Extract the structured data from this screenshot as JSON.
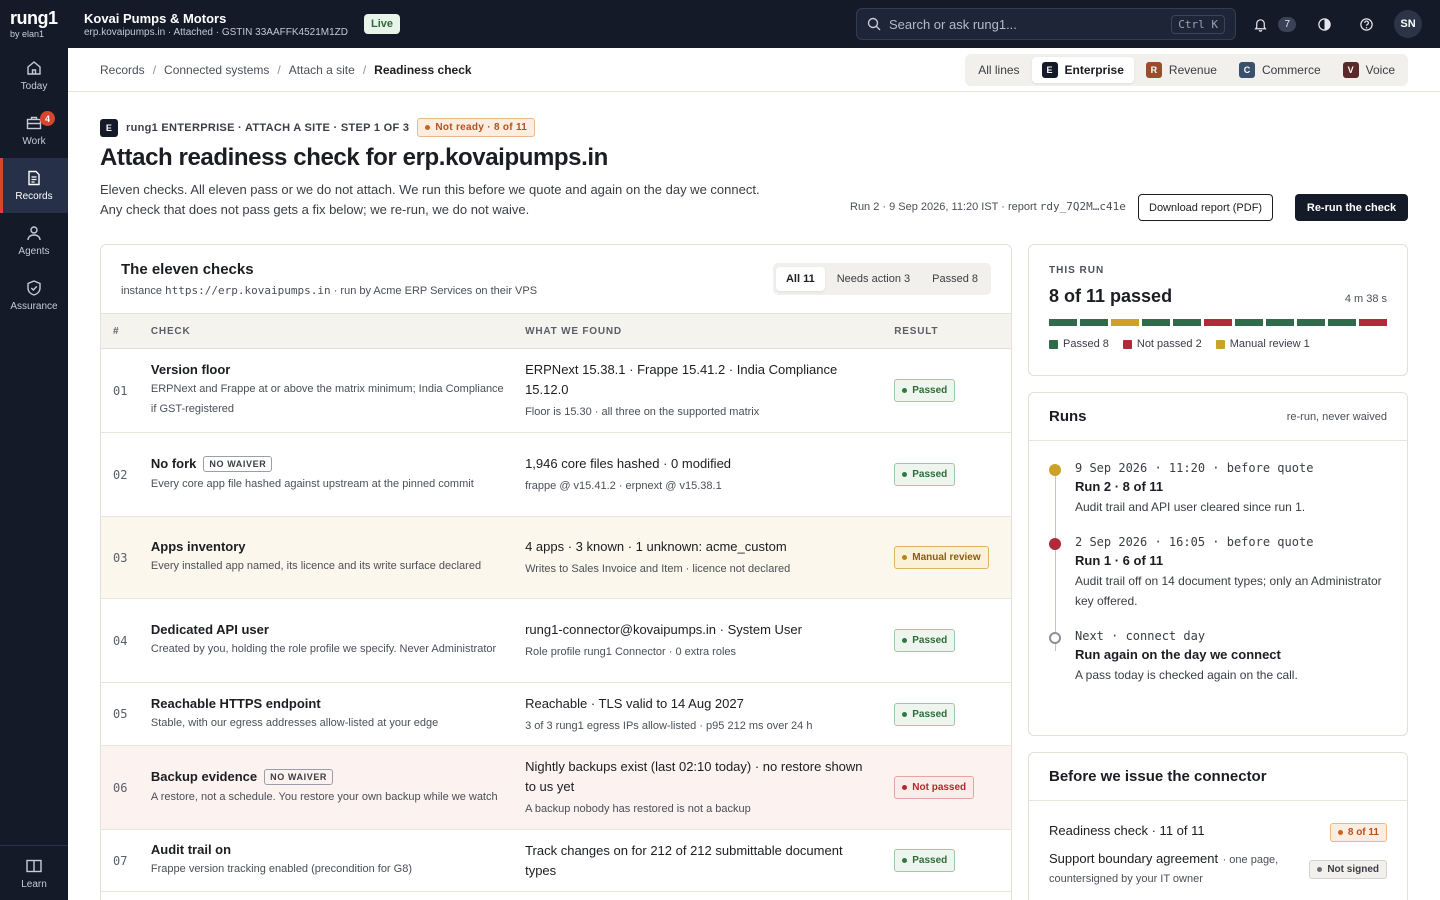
{
  "topbar": {
    "logo": "rung1",
    "logo_sub": "by elan1",
    "org_name": "Kovai Pumps & Motors",
    "org_sub": "erp.kovaipumps.in · Attached · GSTIN 33AAFFK4521M1ZD",
    "live": "Live",
    "search_placeholder": "Search or ask rung1...",
    "search_kbd": "Ctrl K",
    "notif_count": "7",
    "avatar": "SN"
  },
  "nav": {
    "items": [
      {
        "label": "Today",
        "icon": "home-icon"
      },
      {
        "label": "Work",
        "icon": "briefcase-icon",
        "badge": "4"
      },
      {
        "label": "Records",
        "icon": "document-icon"
      },
      {
        "label": "Agents",
        "icon": "person-icon"
      },
      {
        "label": "Assurance",
        "icon": "shield-check-icon"
      }
    ],
    "learn": "Learn"
  },
  "breadcrumb": [
    "Records",
    "Connected systems",
    "Attach a site",
    "Readiness check"
  ],
  "lines": {
    "all": "All lines",
    "tabs": [
      {
        "chip": "E",
        "label": "Enterprise",
        "color": "#141a27"
      },
      {
        "chip": "R",
        "label": "Revenue",
        "color": "#9a4d2c"
      },
      {
        "chip": "C",
        "label": "Commerce",
        "color": "#3b4f6e"
      },
      {
        "chip": "V",
        "label": "Voice",
        "color": "#5a2a2a"
      }
    ]
  },
  "header": {
    "chip": "E",
    "eyebrow": "rung1 ENTERPRISE · ATTACH A SITE · STEP 1 OF 3",
    "status": "Not ready · 8 of 11",
    "title": "Attach readiness check for erp.kovaipumps.in",
    "lede": "Eleven checks. All eleven pass or we do not attach. We run this before we quote and again on the day we connect. Any check that does not pass gets a fix below; we re-run, we do not waive.",
    "run_meta": "Run 2 · 9 Sep 2026, 11:20 IST · report",
    "report_id": "rdy_7Q2M…c41e",
    "download": "Download report (PDF)",
    "rerun": "Re-run the check"
  },
  "checks": {
    "title": "The eleven checks",
    "sub_prefix": "instance",
    "sub_url": "https://erp.kovaipumps.in",
    "sub_suffix": "· run by Acme ERP Services on their VPS",
    "filters": [
      "All 11",
      "Needs action 3",
      "Passed 8"
    ],
    "columns": [
      "#",
      "CHECK",
      "WHAT WE FOUND",
      "RESULT"
    ],
    "rows": [
      {
        "num": "01",
        "title": "Version floor",
        "tag": "",
        "desc": "ERPNext and Frappe at or above the matrix minimum; India Compliance if GST-registered",
        "found": "ERPNext 15.38.1 · Frappe 15.41.2 · India Compliance 15.12.0",
        "found_sub": "Floor is 15.30 · all three on the supported matrix",
        "result": "Passed",
        "kind": "pass"
      },
      {
        "num": "02",
        "title": "No fork",
        "tag": "NO WAIVER",
        "desc": "Every core app file hashed against upstream at the pinned commit",
        "found": "1,946 core files hashed · 0 modified",
        "found_sub": "frappe @ v15.41.2 · erpnext @ v15.38.1",
        "result": "Passed",
        "kind": "pass"
      },
      {
        "num": "03",
        "title": "Apps inventory",
        "tag": "",
        "desc": "Every installed app named, its licence and its write surface declared",
        "found": "4 apps · 3 known · 1 unknown: acme_custom",
        "found_sub": "Writes to Sales Invoice and Item · licence not declared",
        "result": "Manual review",
        "kind": "review"
      },
      {
        "num": "04",
        "title": "Dedicated API user",
        "tag": "",
        "desc": "Created by you, holding the role profile we specify. Never Administrator",
        "found": "rung1-connector@kovaipumps.in · System User",
        "found_sub": "Role profile rung1 Connector · 0 extra roles",
        "result": "Passed",
        "kind": "pass"
      },
      {
        "num": "05",
        "title": "Reachable HTTPS endpoint",
        "tag": "",
        "desc": "Stable, with our egress addresses allow-listed at your edge",
        "found": "Reachable · TLS valid to 14 Aug 2027",
        "found_sub": "3 of 3 rung1 egress IPs allow-listed · p95 212 ms over 24 h",
        "result": "Passed",
        "kind": "pass"
      },
      {
        "num": "06",
        "title": "Backup evidence",
        "tag": "NO WAIVER",
        "desc": "A restore, not a schedule. You restore your own backup while we watch",
        "found": "Nightly backups exist (last 02:10 today) · no restore shown to us yet",
        "found_sub": "A backup nobody has restored is not a backup",
        "result": "Not passed",
        "kind": "fail"
      },
      {
        "num": "07",
        "title": "Audit trail on",
        "tag": "",
        "desc": "Frappe version tracking enabled (precondition for G8)",
        "found": "Track changes on for 212 of 212 submittable document types",
        "found_sub": "",
        "result": "Passed",
        "kind": "pass"
      }
    ]
  },
  "this_run": {
    "label": "THIS RUN",
    "value": "8 of 11 passed",
    "time": "4 m 38 s",
    "segments": [
      "pass",
      "pass",
      "review",
      "pass",
      "pass",
      "fail",
      "pass",
      "pass",
      "pass",
      "pass",
      "fail"
    ],
    "legend": [
      "Passed 8",
      "Not passed 2",
      "Manual review 1"
    ],
    "colors": {
      "pass": "#2f6b4a",
      "fail": "#b02a3a",
      "review": "#c9a227"
    }
  },
  "runs": {
    "title": "Runs",
    "sub": "re-run, never waived",
    "items": [
      {
        "meta": "9 Sep 2026 · 11:20 · before quote",
        "title": "Run 2 · 8 of 11",
        "desc": "Audit trail and API user cleared since run 1.",
        "dot": "#c9a227"
      },
      {
        "meta": "2 Sep 2026 · 16:05 · before quote",
        "title": "Run 1 · 6 of 11",
        "desc": "Audit trail off on 14 document types; only an Administrator key offered.",
        "dot": "#b02a3a"
      },
      {
        "meta": "Next · connect day",
        "title": "Run again on the day we connect",
        "desc": "A pass today is checked again on the call.",
        "dot": "hollow"
      }
    ]
  },
  "before": {
    "title": "Before we issue the connector",
    "items": [
      {
        "title": "Readiness check · 11 of 11",
        "sub": "",
        "badge": "8 of 11",
        "kind": "warn"
      },
      {
        "title": "Support boundary agreement",
        "sub": "· one page, countersigned by your IT owner",
        "badge": "Not signed",
        "kind": "grey"
      }
    ]
  }
}
